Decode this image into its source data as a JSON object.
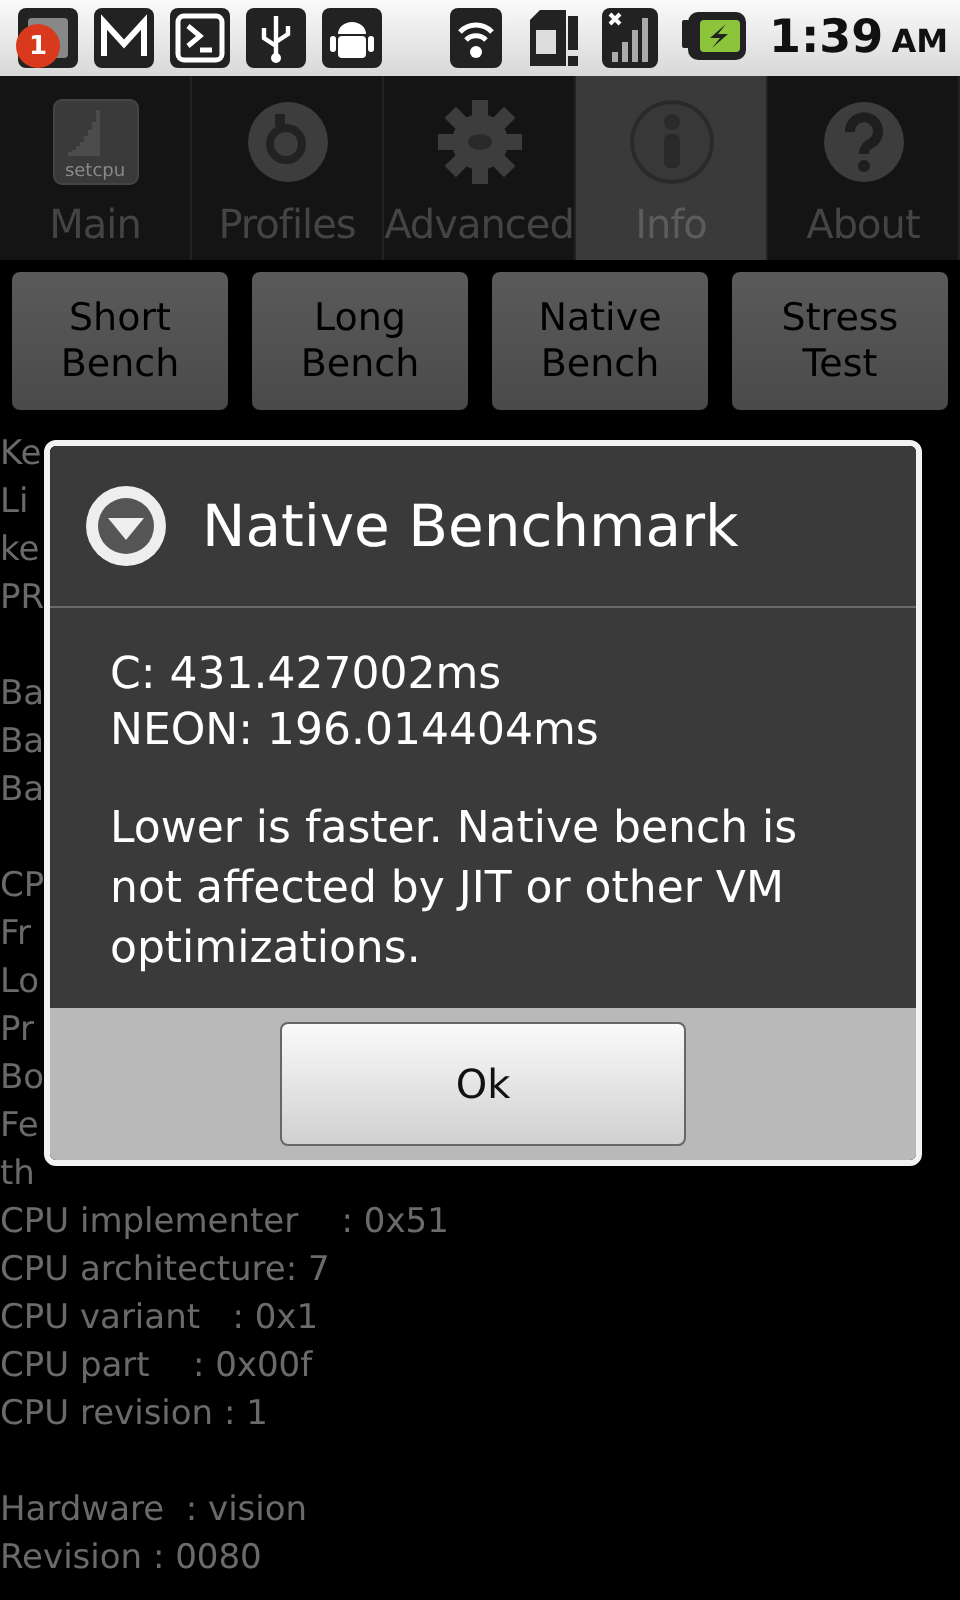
{
  "status_bar": {
    "notifications": [
      {
        "kind": "alert",
        "badge": "1"
      },
      {
        "kind": "mail"
      },
      {
        "kind": "terminal"
      },
      {
        "kind": "usb"
      },
      {
        "kind": "android"
      }
    ],
    "indicators": [
      {
        "kind": "wifi"
      },
      {
        "kind": "sim"
      },
      {
        "kind": "signal"
      },
      {
        "kind": "battery"
      }
    ],
    "time": "1:39",
    "meridiem": "AM"
  },
  "tabs": [
    {
      "kind": "main",
      "label": "Main",
      "logo_text": "setcpu",
      "selected": false
    },
    {
      "kind": "profiles",
      "label": "Profiles",
      "selected": false
    },
    {
      "kind": "advanced",
      "label": "Advanced",
      "selected": false
    },
    {
      "kind": "info",
      "label": "Info",
      "selected": true
    },
    {
      "kind": "about",
      "label": "About",
      "selected": false
    }
  ],
  "actions": [
    "Short Bench",
    "Long Bench",
    "Native Bench",
    "Stress Test"
  ],
  "info_groups": [
    [
      "Ke",
      "Li",
      "ke",
      "PR"
    ],
    [
      "Ba",
      "Ba",
      "Ba"
    ],
    [
      "CP",
      "Fr",
      "Lo",
      "Pr",
      "Bo",
      "Fe",
      "th",
      "CPU implementer    : 0x51",
      "CPU architecture: 7",
      "CPU variant   : 0x1",
      "CPU part    : 0x00f",
      "CPU revision : 1"
    ],
    [
      "Hardware  : vision",
      "Revision : 0080"
    ]
  ],
  "dialog": {
    "title": "Native Benchmark",
    "results": [
      "C: 431.427002ms",
      "NEON: 196.014404ms"
    ],
    "message": "Lower is faster. Native bench is not affected by JIT or other VM optimizations.",
    "button": "Ok"
  }
}
